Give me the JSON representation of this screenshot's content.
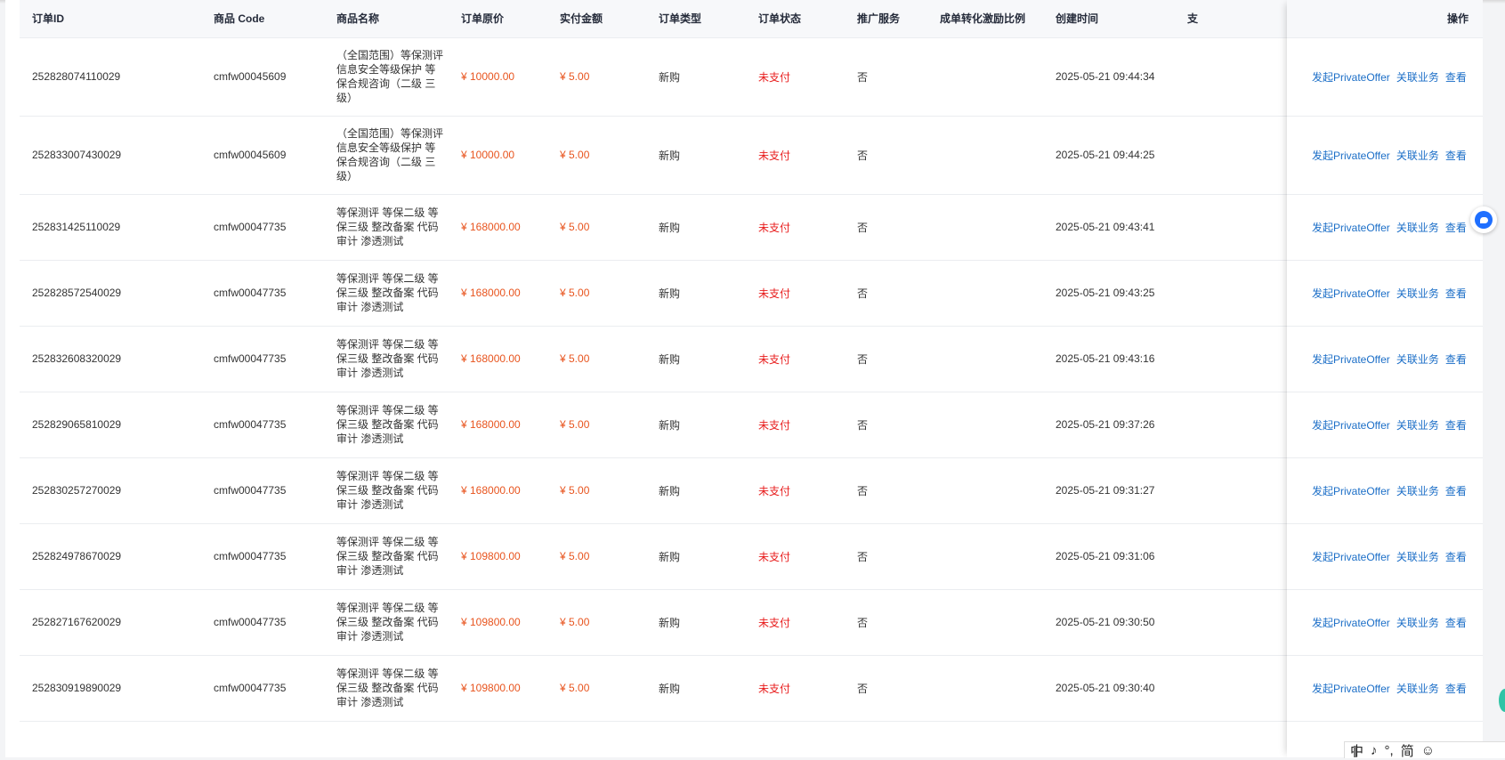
{
  "table": {
    "headers": [
      "订单ID",
      "商品 Code",
      "商品名称",
      "订单原价",
      "实付金额",
      "订单类型",
      "订单状态",
      "推广服务",
      "成单转化激励比例",
      "创建时间",
      "支"
    ],
    "op_header": "操作",
    "actions": [
      "发起PrivateOffer",
      "关联业务",
      "查看"
    ],
    "rows": [
      {
        "id": "252828074110029",
        "code": "cmfw00045609",
        "name": "（全国范围）等保测评 信息安全等级保护 等保合规咨询（二级 三级）",
        "price": "¥ 10000.00",
        "paid": "¥ 5.00",
        "type": "新购",
        "status": "未支付",
        "promo": "否",
        "ratio": "",
        "created": "2025-05-21 09:44:34"
      },
      {
        "id": "252833007430029",
        "code": "cmfw00045609",
        "name": "（全国范围）等保测评 信息安全等级保护 等保合规咨询（二级 三级）",
        "price": "¥ 10000.00",
        "paid": "¥ 5.00",
        "type": "新购",
        "status": "未支付",
        "promo": "否",
        "ratio": "",
        "created": "2025-05-21 09:44:25"
      },
      {
        "id": "252831425110029",
        "code": "cmfw00047735",
        "name": "等保测评 等保二级 等保三级 整改备案 代码审计 渗透测试",
        "price": "¥ 168000.00",
        "paid": "¥ 5.00",
        "type": "新购",
        "status": "未支付",
        "promo": "否",
        "ratio": "",
        "created": "2025-05-21 09:43:41"
      },
      {
        "id": "252828572540029",
        "code": "cmfw00047735",
        "name": "等保测评 等保二级 等保三级 整改备案 代码审计 渗透测试",
        "price": "¥ 168000.00",
        "paid": "¥ 5.00",
        "type": "新购",
        "status": "未支付",
        "promo": "否",
        "ratio": "",
        "created": "2025-05-21 09:43:25"
      },
      {
        "id": "252832608320029",
        "code": "cmfw00047735",
        "name": "等保测评 等保二级 等保三级 整改备案 代码审计 渗透测试",
        "price": "¥ 168000.00",
        "paid": "¥ 5.00",
        "type": "新购",
        "status": "未支付",
        "promo": "否",
        "ratio": "",
        "created": "2025-05-21 09:43:16"
      },
      {
        "id": "252829065810029",
        "code": "cmfw00047735",
        "name": "等保测评 等保二级 等保三级 整改备案 代码审计 渗透测试",
        "price": "¥ 168000.00",
        "paid": "¥ 5.00",
        "type": "新购",
        "status": "未支付",
        "promo": "否",
        "ratio": "",
        "created": "2025-05-21 09:37:26"
      },
      {
        "id": "252830257270029",
        "code": "cmfw00047735",
        "name": "等保测评 等保二级 等保三级 整改备案 代码审计 渗透测试",
        "price": "¥ 168000.00",
        "paid": "¥ 5.00",
        "type": "新购",
        "status": "未支付",
        "promo": "否",
        "ratio": "",
        "created": "2025-05-21 09:31:27"
      },
      {
        "id": "252824978670029",
        "code": "cmfw00047735",
        "name": "等保测评 等保二级 等保三级 整改备案 代码审计 渗透测试",
        "price": "¥ 109800.00",
        "paid": "¥ 5.00",
        "type": "新购",
        "status": "未支付",
        "promo": "否",
        "ratio": "",
        "created": "2025-05-21 09:31:06"
      },
      {
        "id": "252827167620029",
        "code": "cmfw00047735",
        "name": "等保测评 等保二级 等保三级 整改备案 代码审计 渗透测试",
        "price": "¥ 109800.00",
        "paid": "¥ 5.00",
        "type": "新购",
        "status": "未支付",
        "promo": "否",
        "ratio": "",
        "created": "2025-05-21 09:30:50"
      },
      {
        "id": "252830919890029",
        "code": "cmfw00047735",
        "name": "等保测评 等保二级 等保三级 整改备案 代码审计 渗透测试",
        "price": "¥ 109800.00",
        "paid": "¥ 5.00",
        "type": "新购",
        "status": "未支付",
        "promo": "否",
        "ratio": "",
        "created": "2025-05-21 09:30:40"
      }
    ]
  },
  "ime": {
    "items": [
      "中",
      "♪",
      "°,",
      "简",
      "☺"
    ]
  },
  "colors": {
    "price": "#e8541e",
    "status": "#e81c1c",
    "link": "#1b6ec7"
  }
}
